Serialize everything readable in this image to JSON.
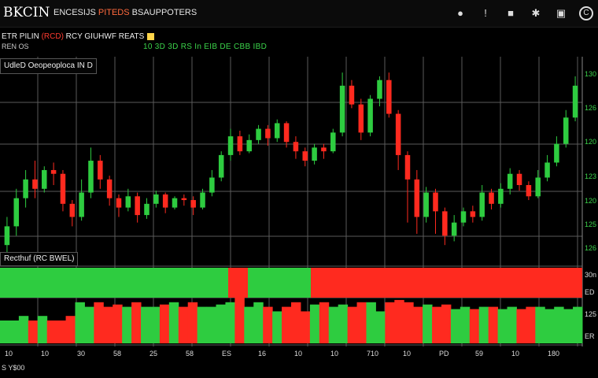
{
  "topbar": {
    "brand": "BKCIN",
    "menu_main": "ENCESIJS ",
    "menu_accent": "PITEDS",
    "menu_rest": " BSAUPPOTERS",
    "icons": [
      "search-icon",
      "alert-icon",
      "camera-icon",
      "settings-icon",
      "calculator-icon",
      "chart-icon"
    ]
  },
  "infobar": {
    "line1_a": "ETR PILIN ",
    "line1_b": "(RCD)",
    "line1_c": " RCY GIUHWF REATS",
    "line2_left": "REN   OS",
    "line2_right": "10   3D   3D   RS   In   EIB   DE   CBB   IBD"
  },
  "chart": {
    "title": "UdleD Oeopeoploca IN D",
    "volume_title": "Recthuf (RC BWEL)",
    "price_labels": [
      "130",
      "126",
      "120",
      "123",
      "120",
      "125",
      "126"
    ],
    "volume_labels": [
      "30n",
      "ED",
      "125",
      "ER"
    ],
    "time_labels": [
      "10",
      "10",
      "30",
      "58",
      "25",
      "58",
      "ES",
      "16",
      "10",
      "10",
      "710",
      "10",
      "PD",
      "59",
      "10",
      "180"
    ],
    "colors": {
      "up": "#2ecc40",
      "down": "#ff2a1f",
      "grid": "#5a5a5a"
    }
  },
  "chart_data": {
    "type": "candlestick",
    "candles": [
      [
        2,
        3,
        1.5,
        3.5
      ],
      [
        3,
        4.5,
        2.5,
        5
      ],
      [
        4.5,
        5.5,
        4,
        6
      ],
      [
        5.5,
        5,
        4.5,
        6.5
      ],
      [
        5,
        6,
        4.8,
        6.2
      ],
      [
        6,
        5.8,
        5.2,
        6.4
      ],
      [
        5.8,
        4.2,
        3.8,
        6
      ],
      [
        4.2,
        3.5,
        3,
        4.4
      ],
      [
        3.5,
        4.8,
        3.3,
        5.5
      ],
      [
        4.8,
        6.5,
        4.5,
        7.2
      ],
      [
        6.5,
        5.5,
        5,
        6.8
      ],
      [
        5.5,
        4.5,
        4.1,
        5.7
      ],
      [
        4.5,
        4.0,
        3.5,
        4.7
      ],
      [
        4,
        4.6,
        3.8,
        5
      ],
      [
        4.6,
        3.6,
        3.2,
        4.8
      ],
      [
        3.6,
        4.2,
        3.4,
        4.5
      ],
      [
        4.2,
        4.7,
        4,
        4.9
      ],
      [
        4.7,
        4.0,
        3.7,
        4.8
      ],
      [
        4,
        4.5,
        3.9,
        4.6
      ],
      [
        4.5,
        4.4,
        4.1,
        4.7
      ],
      [
        4.4,
        4.0,
        3.6,
        4.6
      ],
      [
        4,
        4.8,
        3.9,
        5.0
      ],
      [
        4.8,
        5.6,
        4.6,
        6.0
      ],
      [
        5.6,
        6.8,
        5.4,
        7.0
      ],
      [
        6.8,
        7.8,
        6.5,
        8.2
      ],
      [
        7.8,
        7.0,
        6.8,
        8.1
      ],
      [
        7.0,
        7.6,
        6.9,
        7.9
      ],
      [
        7.6,
        8.2,
        7.4,
        8.4
      ],
      [
        8.2,
        7.7,
        7.3,
        8.4
      ],
      [
        7.7,
        8.5,
        7.5,
        8.7
      ],
      [
        8.5,
        7.5,
        7.2,
        8.6
      ],
      [
        7.5,
        7.0,
        6.6,
        7.8
      ],
      [
        7.0,
        6.5,
        6.2,
        7.2
      ],
      [
        6.5,
        7.2,
        6.3,
        7.4
      ],
      [
        7.2,
        7.0,
        6.6,
        7.4
      ],
      [
        7.0,
        8.0,
        6.9,
        8.2
      ],
      [
        8.0,
        10.5,
        7.8,
        11.2
      ],
      [
        10.5,
        9.5,
        9.3,
        10.8
      ],
      [
        9.5,
        8.0,
        7.6,
        9.8
      ],
      [
        8.0,
        9.8,
        7.8,
        10.0
      ],
      [
        9.8,
        10.8,
        9.4,
        11.0
      ],
      [
        10.8,
        9.0,
        8.8,
        11.2
      ],
      [
        9.0,
        6.8,
        6.0,
        9.2
      ],
      [
        6.8,
        5.5,
        3.2,
        7.0
      ],
      [
        5.5,
        3.5,
        2.6,
        6.0
      ],
      [
        3.5,
        4.8,
        3.2,
        5.1
      ],
      [
        4.8,
        3.8,
        2.6,
        5.0
      ],
      [
        3.8,
        2.5,
        2.0,
        4.0
      ],
      [
        2.5,
        3.2,
        2.2,
        3.6
      ],
      [
        3.2,
        3.8,
        3.0,
        4.0
      ],
      [
        3.8,
        3.5,
        3.2,
        4.1
      ],
      [
        3.5,
        4.8,
        3.3,
        5.2
      ],
      [
        4.8,
        4.2,
        3.9,
        5.0
      ],
      [
        4.2,
        5.0,
        4.0,
        5.3
      ],
      [
        5.0,
        5.8,
        4.7,
        6.1
      ],
      [
        5.8,
        5.2,
        4.9,
        6.0
      ],
      [
        5.2,
        4.6,
        4.4,
        5.4
      ],
      [
        4.6,
        5.6,
        4.5,
        6.0
      ],
      [
        5.6,
        6.4,
        5.4,
        6.8
      ],
      [
        6.4,
        7.4,
        6.2,
        7.8
      ],
      [
        7.4,
        8.8,
        7.2,
        9.2
      ],
      [
        8.8,
        10.5,
        8.6,
        11.0
      ]
    ],
    "volume_top": [
      1,
      1,
      1,
      1,
      1,
      1,
      1,
      1,
      1,
      1,
      1,
      1,
      1,
      1,
      1,
      1,
      1,
      1,
      1,
      1,
      1,
      1,
      1,
      1,
      1,
      1,
      1,
      1,
      1,
      1,
      1,
      1,
      1,
      1,
      1,
      1,
      1,
      1,
      1,
      1,
      1,
      1,
      1,
      1,
      1,
      1,
      1,
      1,
      1,
      1,
      1,
      1,
      1,
      1,
      1,
      1,
      1,
      1,
      1,
      1,
      1,
      1
    ],
    "volume_bottom": [
      0.5,
      0.5,
      0.6,
      0.5,
      0.6,
      0.5,
      0.5,
      0.6,
      0.9,
      0.8,
      0.9,
      0.8,
      0.85,
      0.8,
      0.9,
      0.8,
      0.8,
      0.85,
      0.9,
      0.8,
      0.9,
      0.8,
      0.8,
      0.85,
      0.9,
      1.0,
      0.8,
      0.9,
      0.8,
      0.7,
      0.8,
      0.9,
      0.7,
      0.85,
      0.9,
      0.8,
      0.85,
      0.8,
      0.9,
      0.9,
      0.7,
      0.9,
      0.95,
      0.9,
      0.8,
      0.85,
      0.8,
      0.85,
      0.75,
      0.8,
      0.75,
      0.8,
      0.8,
      0.75,
      0.8,
      0.75,
      0.8,
      0.8,
      0.75,
      0.8,
      0.75,
      0.8
    ]
  },
  "footer": {
    "text": "S Y$00"
  }
}
